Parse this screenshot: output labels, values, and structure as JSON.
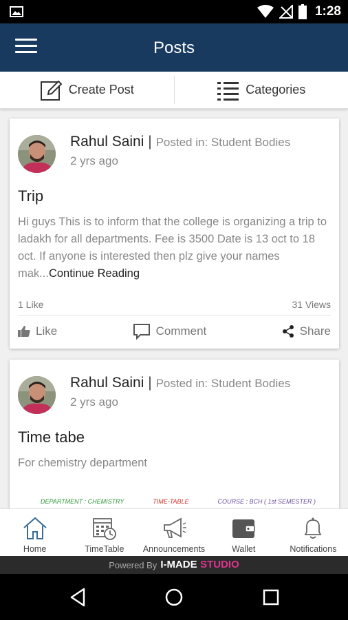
{
  "status_bar": {
    "time": "1:28"
  },
  "app_bar": {
    "title": "Posts"
  },
  "actions": {
    "create_post": "Create Post",
    "categories": "Categories"
  },
  "posts": [
    {
      "author": "Rahul Saini",
      "separator": "|",
      "posted_in": "Posted in: Student Bodies",
      "time_ago": "2 yrs ago",
      "title": "Trip",
      "body": "Hi guys This is to inform that the college is organizing a trip to ladakh for all departments. Fee is 3500 Date is 13 oct to 18 oct. If anyone is interested then plz give your names mak...",
      "continue": "Continue Reading",
      "likes": "1 Like",
      "views": "31 Views",
      "like_label": "Like",
      "comment_label": "Comment",
      "share_label": "Share"
    },
    {
      "author": "Rahul Saini",
      "separator": "|",
      "posted_in": "Posted in: Student Bodies",
      "time_ago": "2 yrs ago",
      "title": "Time tabe",
      "body": "For chemistry department",
      "attachment": {
        "left": "DEPARTMENT : CHEMISTRY",
        "center": "TIME-TABLE",
        "right": "COURSE : BCH ( 1st SEMESTER )"
      }
    }
  ],
  "bottom_nav": [
    {
      "label": "Home",
      "icon": "home-icon"
    },
    {
      "label": "TimeTable",
      "icon": "timetable-icon"
    },
    {
      "label": "Announcements",
      "icon": "megaphone-icon"
    },
    {
      "label": "Wallet",
      "icon": "wallet-icon"
    },
    {
      "label": "Notifications",
      "icon": "bell-icon"
    }
  ],
  "footer": {
    "powered_by": "Powered By",
    "brand_part1": "I-MADE",
    "brand_part2": "STUDIO"
  },
  "colors": {
    "app_bar": "#173a5e",
    "brand_pink": "#e0338e",
    "home_active": "#3a6a96"
  }
}
